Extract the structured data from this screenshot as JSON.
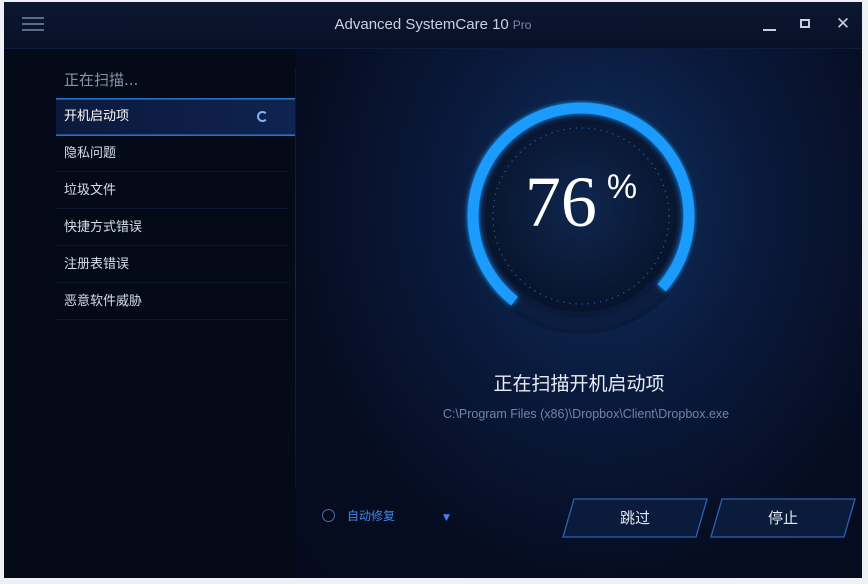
{
  "window": {
    "title": "Advanced SystemCare 10",
    "edition": "Pro"
  },
  "controls": {
    "close": "✕"
  },
  "sidebar": {
    "heading": "正在扫描...",
    "items": [
      {
        "label": "开机启动项",
        "active": true
      },
      {
        "label": "隐私问题"
      },
      {
        "label": "垃圾文件"
      },
      {
        "label": "快捷方式错误"
      },
      {
        "label": "注册表错误"
      },
      {
        "label": "恶意软件威胁"
      }
    ]
  },
  "scan": {
    "percent": "76",
    "percent_sign": "%",
    "progress": 0.76,
    "status": "正在扫描开机启动项",
    "current_file": "C:\\Program Files (x86)\\Dropbox\\Client\\Dropbox.exe"
  },
  "footer": {
    "auto_repair_label": "自动修复",
    "skip_label": "跳过",
    "stop_label": "停止"
  },
  "colors": {
    "accent": "#1e9bff",
    "background": "#050b1c",
    "link": "#3f86e8"
  },
  "icons": [
    "menu-icon",
    "minimize-icon",
    "maximize-icon",
    "close-icon",
    "spinner-icon",
    "chevron-down-icon"
  ]
}
